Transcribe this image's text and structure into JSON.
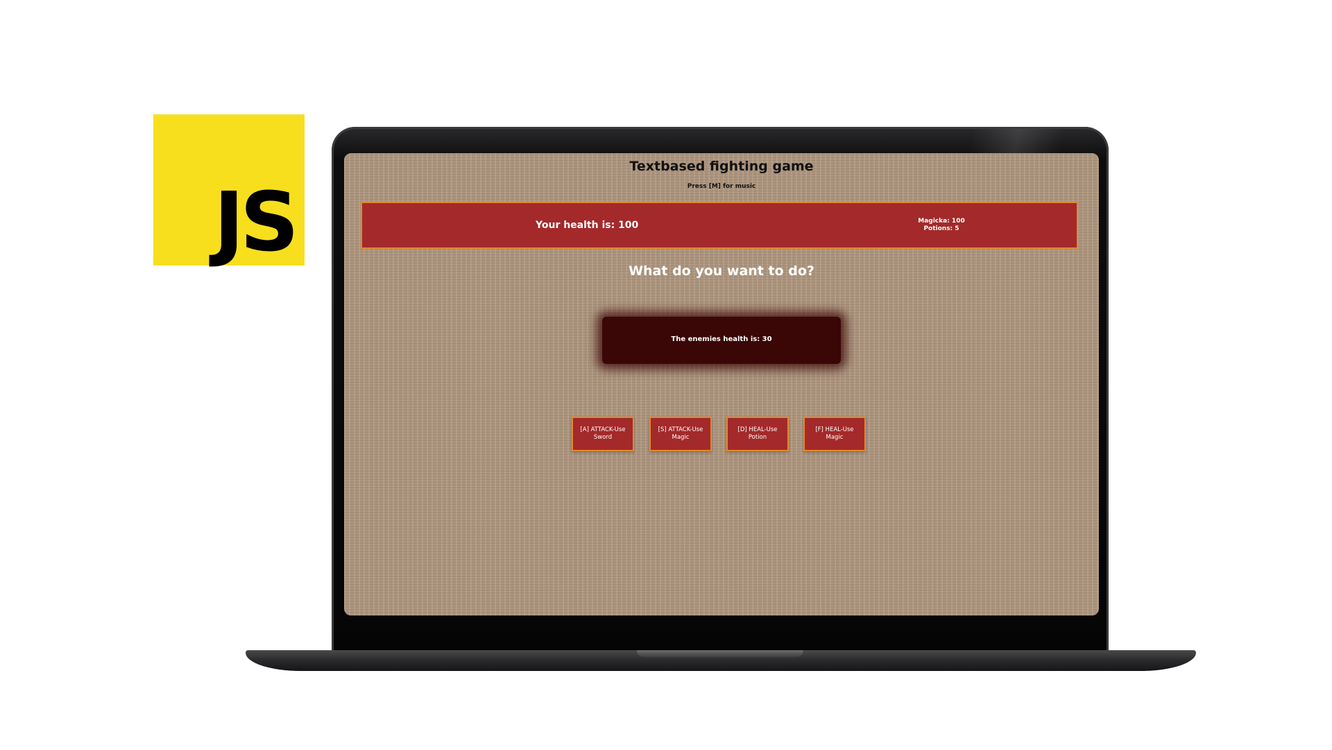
{
  "logo": {
    "text": "JS",
    "color": "#f7df1e"
  },
  "game": {
    "title": "Textbased fighting game",
    "music_hint": "Press [M] for music",
    "player_health": "Your health is: 100",
    "magicka": "Magicka: 100",
    "potions": "Potions: 5",
    "prompt": "What do you want to do?",
    "enemy_health": "The enemies health is: 30",
    "actions": [
      {
        "label": "[A] ATTACK-Use Sword"
      },
      {
        "label": "[S] ATTACK-Use Magic"
      },
      {
        "label": "[D] HEAL-Use Potion"
      },
      {
        "label": "[F] HEAL-Use Magic"
      }
    ]
  },
  "colors": {
    "panel_red": "#a4292a",
    "panel_border": "#e08a2e",
    "enemy_panel": "#3a0606",
    "background": "#b29a83"
  }
}
